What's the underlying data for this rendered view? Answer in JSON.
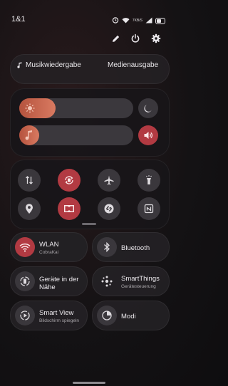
{
  "status_bar": {
    "carrier": "1&1",
    "data_speed": "7KB/S",
    "battery_icon": "battery-icon"
  },
  "top_actions": {
    "edit_icon": "pencil-icon",
    "power_icon": "power-icon",
    "settings_icon": "gear-icon"
  },
  "media": {
    "music_label": "Musikwiedergabe",
    "output_label": "Medienausgabe"
  },
  "sliders": {
    "brightness_level": 0.32,
    "volume_level": 0.17
  },
  "quick_toggles": [
    {
      "name": "mobile-data",
      "icon": "arrows-updown-icon",
      "on": false
    },
    {
      "name": "auto-rotate",
      "icon": "rotate-icon",
      "on": true
    },
    {
      "name": "airplane-mode",
      "icon": "airplane-icon",
      "on": false
    },
    {
      "name": "flashlight",
      "icon": "flashlight-icon",
      "on": false
    },
    {
      "name": "location",
      "icon": "location-pin-icon",
      "on": false
    },
    {
      "name": "dolby-atmos",
      "icon": "dolby-icon",
      "on": true
    },
    {
      "name": "shazam",
      "icon": "shazam-icon",
      "on": false
    },
    {
      "name": "nfc",
      "icon": "nfc-icon",
      "on": false
    }
  ],
  "tiles": {
    "wlan_title": "WLAN",
    "wlan_sub": "CobraKai",
    "bluetooth_title": "Bluetooth",
    "nearby_title_1": "Geräte in der",
    "nearby_title_2": "Nähe",
    "smartthings_title": "SmartThings",
    "smartthings_sub": "Gerätesteuerung",
    "smartview_title": "Smart View",
    "smartview_sub": "Bildschirm spiegeln",
    "modi_title": "Modi"
  },
  "colors": {
    "accent_red": "#b23a42",
    "slider_orange": "#d97a61"
  }
}
